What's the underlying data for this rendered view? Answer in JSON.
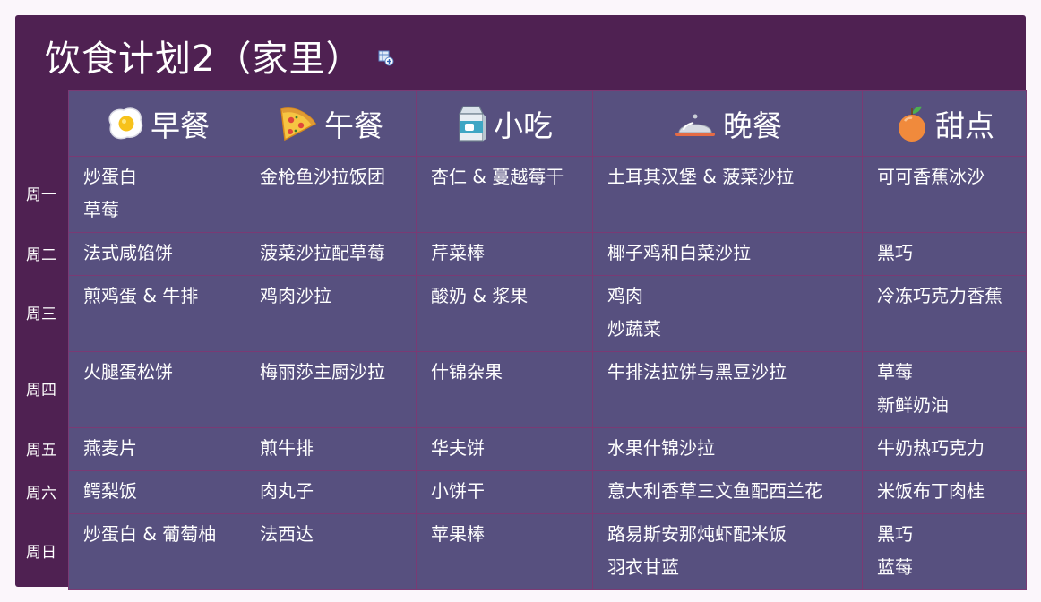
{
  "title": "饮食计划2（家里）",
  "meals": [
    {
      "label": "早餐",
      "icon": "fried-egg-icon"
    },
    {
      "label": "午餐",
      "icon": "pizza-slice-icon"
    },
    {
      "label": "小吃",
      "icon": "milk-carton-icon"
    },
    {
      "label": "晚餐",
      "icon": "food-cloche-icon"
    },
    {
      "label": "甜点",
      "icon": "peach-icon"
    }
  ],
  "days": [
    "周一",
    "周二",
    "周三",
    "周四",
    "周五",
    "周六",
    "周日"
  ],
  "rows": [
    [
      [
        "炒蛋白",
        "草莓"
      ],
      [
        "金枪鱼沙拉饭团"
      ],
      [
        "杏仁 & 蔓越莓干"
      ],
      [
        "土耳其汉堡 & 菠菜沙拉"
      ],
      [
        "可可香蕉冰沙"
      ]
    ],
    [
      [
        "法式咸馅饼"
      ],
      [
        "菠菜沙拉配草莓"
      ],
      [
        "芹菜棒"
      ],
      [
        "椰子鸡和白菜沙拉"
      ],
      [
        "黑巧"
      ]
    ],
    [
      [
        "煎鸡蛋 & 牛排"
      ],
      [
        "鸡肉沙拉"
      ],
      [
        "酸奶 & 浆果"
      ],
      [
        "鸡肉",
        "炒蔬菜"
      ],
      [
        "冷冻巧克力香蕉"
      ]
    ],
    [
      [
        "火腿蛋松饼"
      ],
      [
        "梅丽莎主厨沙拉"
      ],
      [
        "什锦杂果"
      ],
      [
        "牛排法拉饼与黑豆沙拉"
      ],
      [
        "草莓",
        "新鲜奶油"
      ]
    ],
    [
      [
        "燕麦片"
      ],
      [
        "煎牛排"
      ],
      [
        "华夫饼"
      ],
      [
        "水果什锦沙拉"
      ],
      [
        "牛奶热巧克力"
      ]
    ],
    [
      [
        "鳄梨饭"
      ],
      [
        "肉丸子"
      ],
      [
        "小饼干"
      ],
      [
        "意大利香草三文鱼配西兰花"
      ],
      [
        "米饭布丁肉桂"
      ]
    ],
    [
      [
        "炒蛋白 & 葡萄柚"
      ],
      [
        "法西达"
      ],
      [
        "苹果棒"
      ],
      [
        "路易斯安那炖虾配米饭",
        "羽衣甘蓝"
      ],
      [
        "黑巧",
        "蓝莓"
      ]
    ]
  ],
  "colors": {
    "frame": "#4f2152",
    "table": "#57507f",
    "grid": "#7a3a74",
    "text": "#ffffff"
  }
}
